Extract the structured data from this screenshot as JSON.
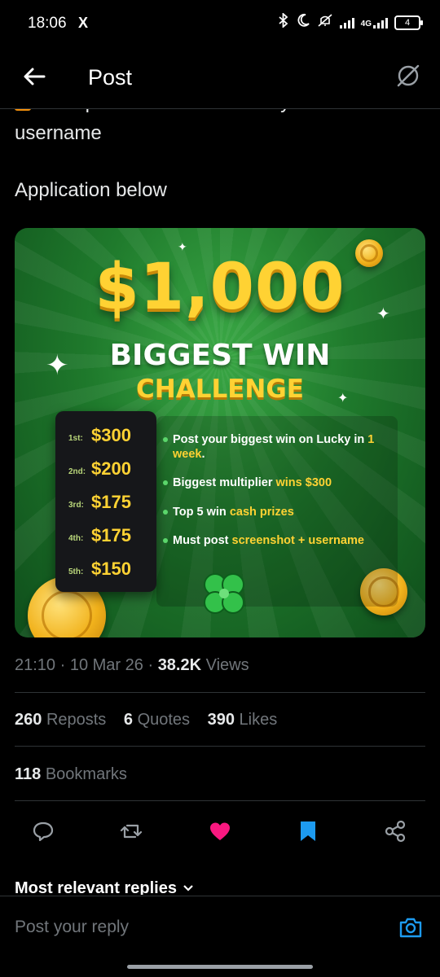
{
  "status_bar": {
    "time": "18:06",
    "app_icon": "X",
    "network": "4G",
    "battery": "4"
  },
  "header": {
    "title": "Post"
  },
  "post": {
    "cut_line": "Must post screenshot + lucky",
    "line2": "username",
    "line3": "Application below"
  },
  "promo": {
    "amount": "$1,000",
    "headline1": "BIGGEST WIN",
    "headline2": "CHALLENGE",
    "prizes": [
      {
        "place": "1st:",
        "amount": "$300"
      },
      {
        "place": "2nd:",
        "amount": "$200"
      },
      {
        "place": "3rd:",
        "amount": "$175"
      },
      {
        "place": "4th:",
        "amount": "$175"
      },
      {
        "place": "5th:",
        "amount": "$150"
      }
    ],
    "bullets": {
      "b1_text": "Post your biggest win on Lucky in ",
      "b1_hl": "1 week",
      "b1_end": ".",
      "b2_text": "Biggest multiplier ",
      "b2_hl": "wins $300",
      "b3_text": "Top 5 win ",
      "b3_hl": "cash prizes",
      "b4_text": "Must post ",
      "b4_hl": "screenshot + username"
    }
  },
  "meta": {
    "time": "21:10",
    "date": "10 Mar 26",
    "views_count": "38.2K",
    "views_label": "Views"
  },
  "stats": {
    "reposts_count": "260",
    "reposts_label": "Reposts",
    "quotes_count": "6",
    "quotes_label": "Quotes",
    "likes_count": "390",
    "likes_label": "Likes",
    "bookmarks_count": "118",
    "bookmarks_label": "Bookmarks"
  },
  "actions": {
    "icons": [
      "reply-icon",
      "repost-icon",
      "like-icon",
      "bookmark-icon",
      "share-icon"
    ],
    "like_color": "#f91880",
    "bookmark_color": "#1d9bf0"
  },
  "replies": {
    "heading": "Most relevant replies"
  },
  "reply_bar": {
    "placeholder": "Post your reply"
  }
}
